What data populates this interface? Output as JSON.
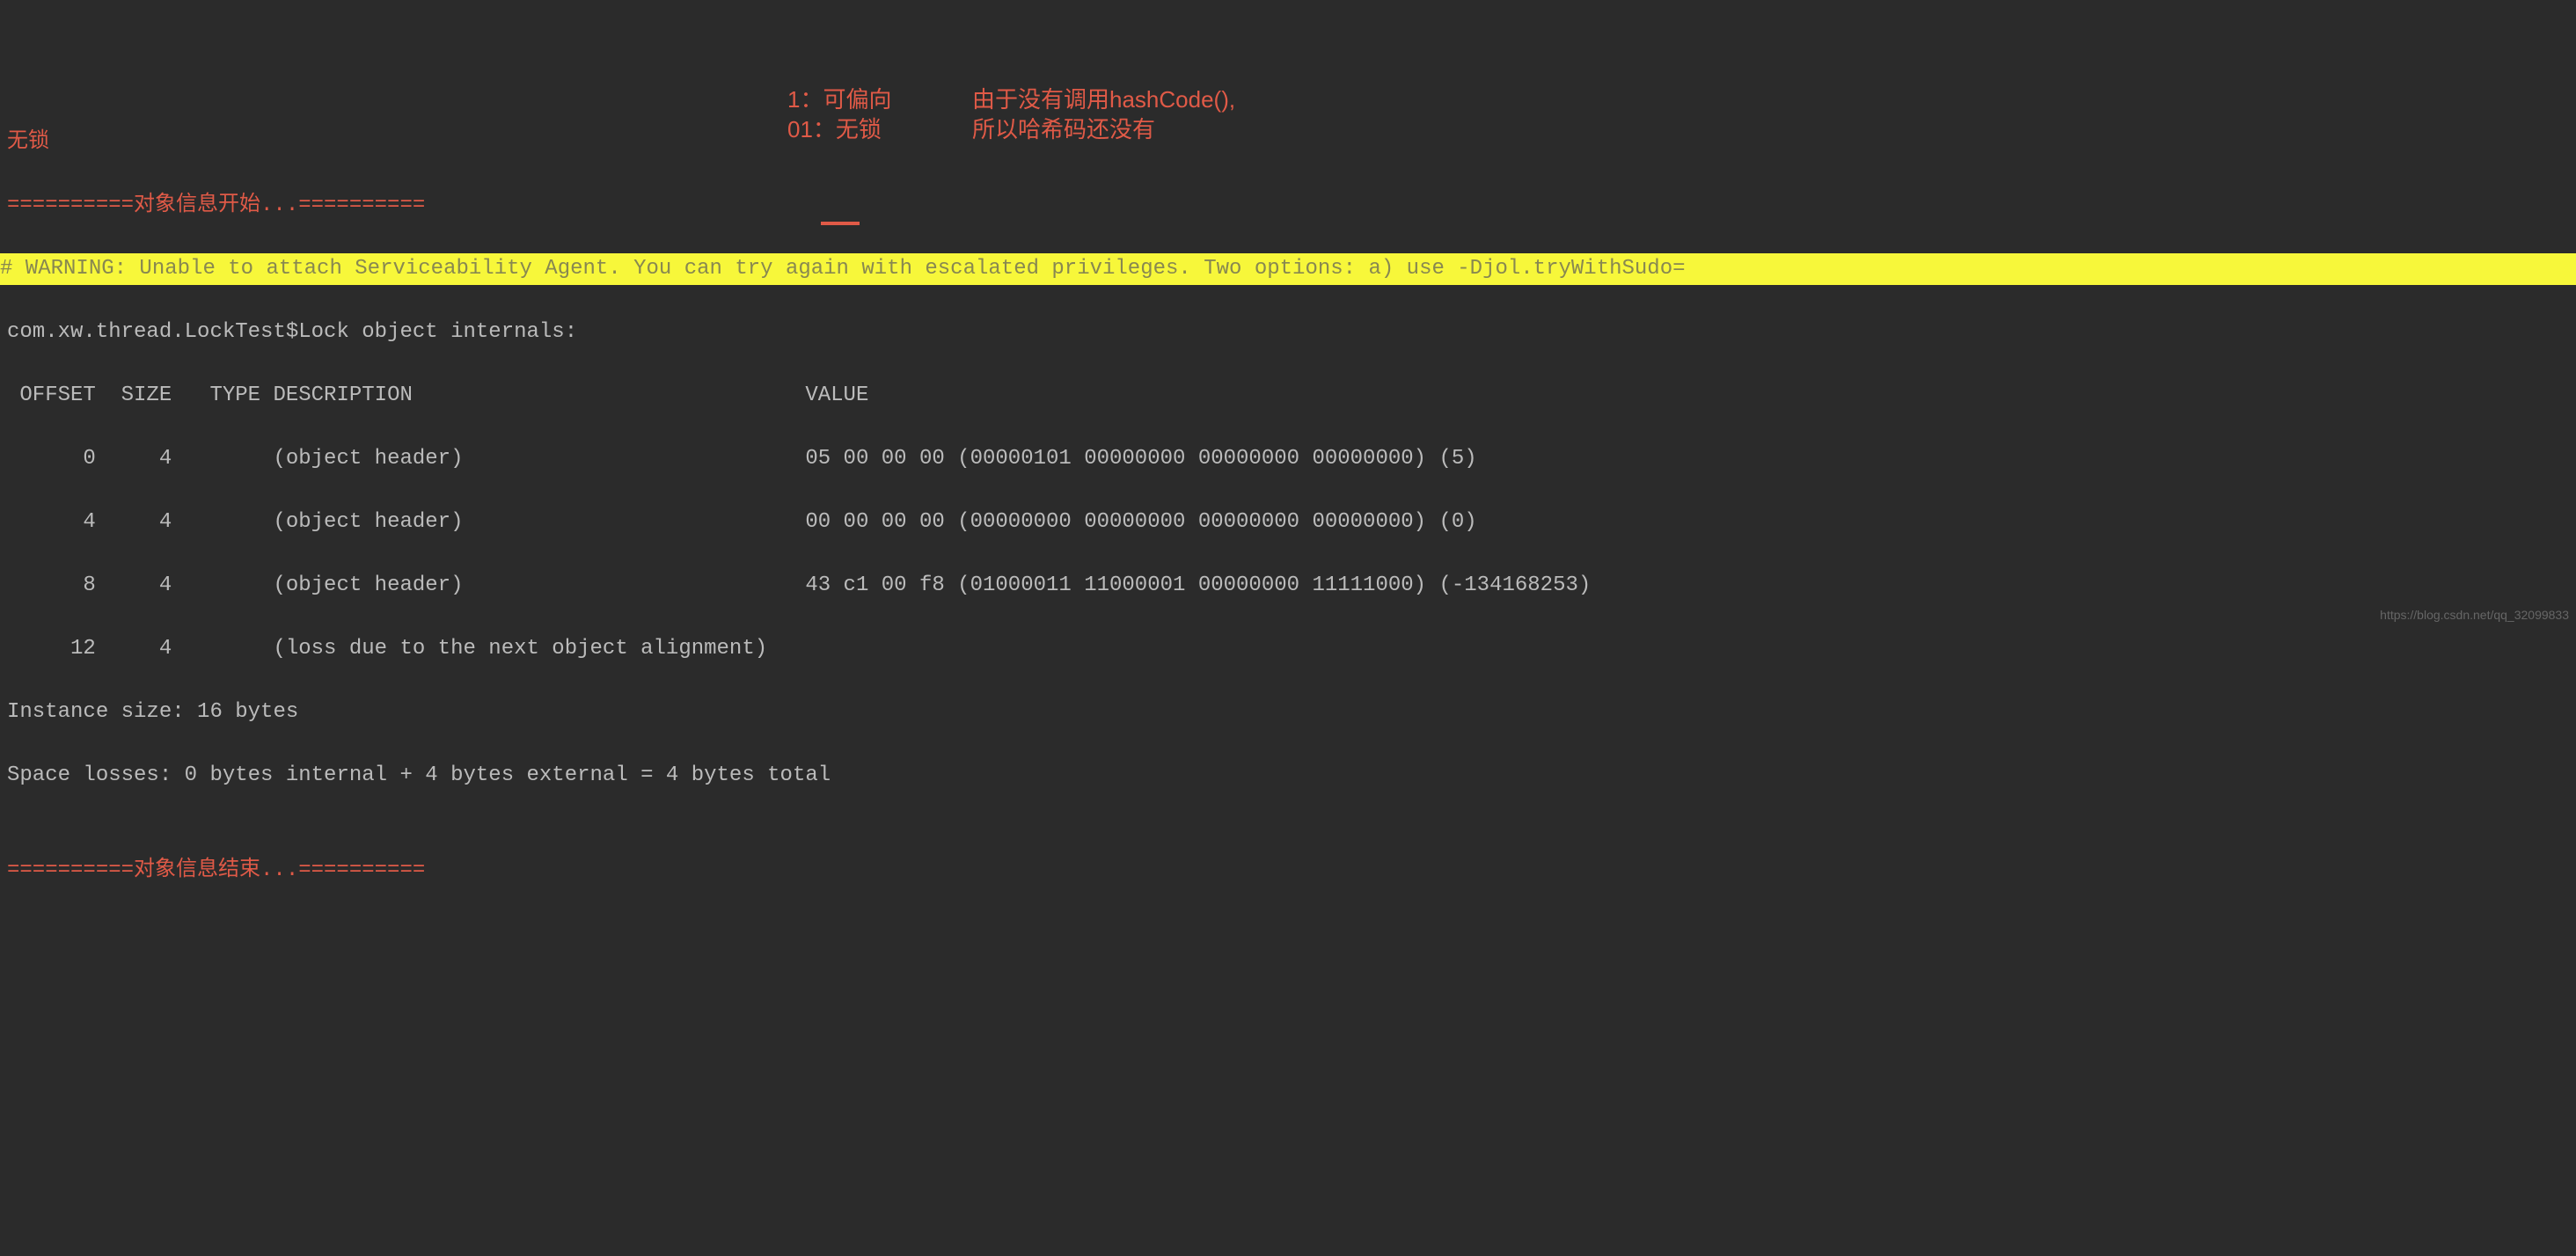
{
  "lines": {
    "title": "无锁",
    "start_marker": "==========对象信息开始...==========",
    "warning": "# WARNING: Unable to attach Serviceability Agent. You can try again with escalated privileges. Two options: a) use -Djol.tryWithSudo=",
    "object_header": "com.xw.thread.LockTest$Lock object internals:",
    "table_header": " OFFSET  SIZE   TYPE DESCRIPTION                               VALUE",
    "row1": "      0     4        (object header)                           05 00 00 00 (00000101 00000000 00000000 00000000) (5)",
    "row2": "      4     4        (object header)                           00 00 00 00 (00000000 00000000 00000000 00000000) (0)",
    "row3": "      8     4        (object header)                           43 c1 00 f8 (01000011 11000001 00000000 11111000) (-134168253)",
    "row4": "     12     4        (loss due to the next object alignment)",
    "instance_size": "Instance size: 16 bytes",
    "space_losses": "Space losses: 0 bytes internal + 4 bytes external = 4 bytes total",
    "blank": "",
    "end_marker": "==========对象信息结束...=========="
  },
  "annotations": {
    "biasable": "1：可偏向",
    "nolock": "01：无锁",
    "hashcode1": "由于没有调用hashCode(),",
    "hashcode2": "所以哈希码还没有"
  },
  "watermark": "https://blog.csdn.net/qq_32099833"
}
